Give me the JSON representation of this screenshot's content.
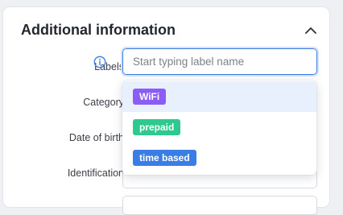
{
  "section": {
    "title": "Additional information",
    "collapse_icon": "chevron-up-icon"
  },
  "fields": {
    "labels": {
      "label": "Labels",
      "info_icon": "info-icon",
      "placeholder": "Start typing label name",
      "value": ""
    },
    "category": {
      "label": "Category"
    },
    "date_of_birth": {
      "label": "Date of birth"
    },
    "identification": {
      "label": "Identification"
    }
  },
  "dropdown": {
    "options": [
      {
        "text": "WiFi",
        "color": "#8b5cf6",
        "highlighted": true
      },
      {
        "text": "prepaid",
        "color": "#2ec98e",
        "highlighted": false
      },
      {
        "text": "time based",
        "color": "#3b7de6",
        "highlighted": false
      }
    ]
  },
  "colors": {
    "accent": "#3d7be0",
    "highlight": "#e9f0fd"
  }
}
